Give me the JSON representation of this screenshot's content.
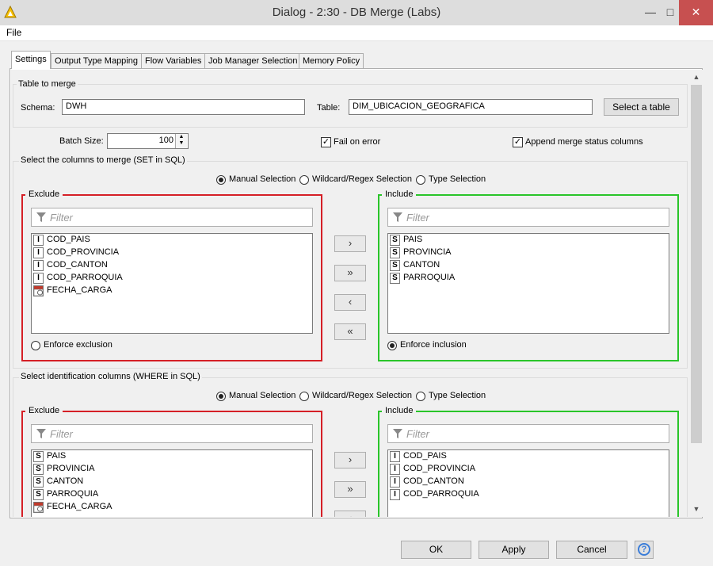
{
  "window": {
    "title": "Dialog - 2:30 - DB Merge (Labs)",
    "minimize": "—",
    "maximize": "□",
    "close": "✕"
  },
  "menu": {
    "file": "File"
  },
  "tabs": [
    "Settings",
    "Output Type Mapping",
    "Flow Variables",
    "Job Manager Selection",
    "Memory Policy"
  ],
  "table_to_merge": {
    "title": "Table to merge",
    "schema_label": "Schema:",
    "schema_value": "DWH",
    "table_label": "Table:",
    "table_value": "DIM_UBICACION_GEOGRAFICA",
    "select_button": "Select a table"
  },
  "options": {
    "batch_label": "Batch Size:",
    "batch_value": "100",
    "fail_on_error": "Fail on error",
    "fail_on_error_checked": true,
    "append_status": "Append merge status columns",
    "append_status_checked": true
  },
  "set_section": {
    "title": "Select the columns to merge (SET in SQL)",
    "modes": [
      "Manual Selection",
      "Wildcard/Regex Selection",
      "Type Selection"
    ],
    "selected_mode": 0,
    "exclude_title": "Exclude",
    "include_title": "Include",
    "filter_placeholder": "Filter",
    "exclude_items": [
      {
        "type": "I",
        "name": "COD_PAIS"
      },
      {
        "type": "I",
        "name": "COD_PROVINCIA"
      },
      {
        "type": "I",
        "name": "COD_CANTON"
      },
      {
        "type": "I",
        "name": "COD_PARROQUIA"
      },
      {
        "type": "date",
        "name": "FECHA_CARGA"
      }
    ],
    "include_items": [
      {
        "type": "S",
        "name": "PAIS"
      },
      {
        "type": "S",
        "name": "PROVINCIA"
      },
      {
        "type": "S",
        "name": "CANTON"
      },
      {
        "type": "S",
        "name": "PARROQUIA"
      }
    ],
    "enforce_exclusion": "Enforce exclusion",
    "enforce_inclusion": "Enforce inclusion",
    "enforce_selected": "inclusion"
  },
  "where_section": {
    "title": "Select identification columns (WHERE in SQL)",
    "modes": [
      "Manual Selection",
      "Wildcard/Regex Selection",
      "Type Selection"
    ],
    "selected_mode": 0,
    "exclude_title": "Exclude",
    "include_title": "Include",
    "filter_placeholder": "Filter",
    "exclude_items": [
      {
        "type": "S",
        "name": "PAIS"
      },
      {
        "type": "S",
        "name": "PROVINCIA"
      },
      {
        "type": "S",
        "name": "CANTON"
      },
      {
        "type": "S",
        "name": "PARROQUIA"
      },
      {
        "type": "date",
        "name": "FECHA_CARGA"
      }
    ],
    "include_items": [
      {
        "type": "I",
        "name": "COD_PAIS"
      },
      {
        "type": "I",
        "name": "COD_PROVINCIA"
      },
      {
        "type": "I",
        "name": "COD_CANTON"
      },
      {
        "type": "I",
        "name": "COD_PARROQUIA"
      }
    ]
  },
  "transfer_buttons": {
    "add": "›",
    "add_all": "»",
    "remove": "‹",
    "remove_all": "«"
  },
  "footer": {
    "ok": "OK",
    "apply": "Apply",
    "cancel": "Cancel",
    "help": "?"
  },
  "colors": {
    "exclude_border": "#d51f26",
    "include_border": "#2ac52a",
    "help_icon": "#3b7dd8"
  }
}
